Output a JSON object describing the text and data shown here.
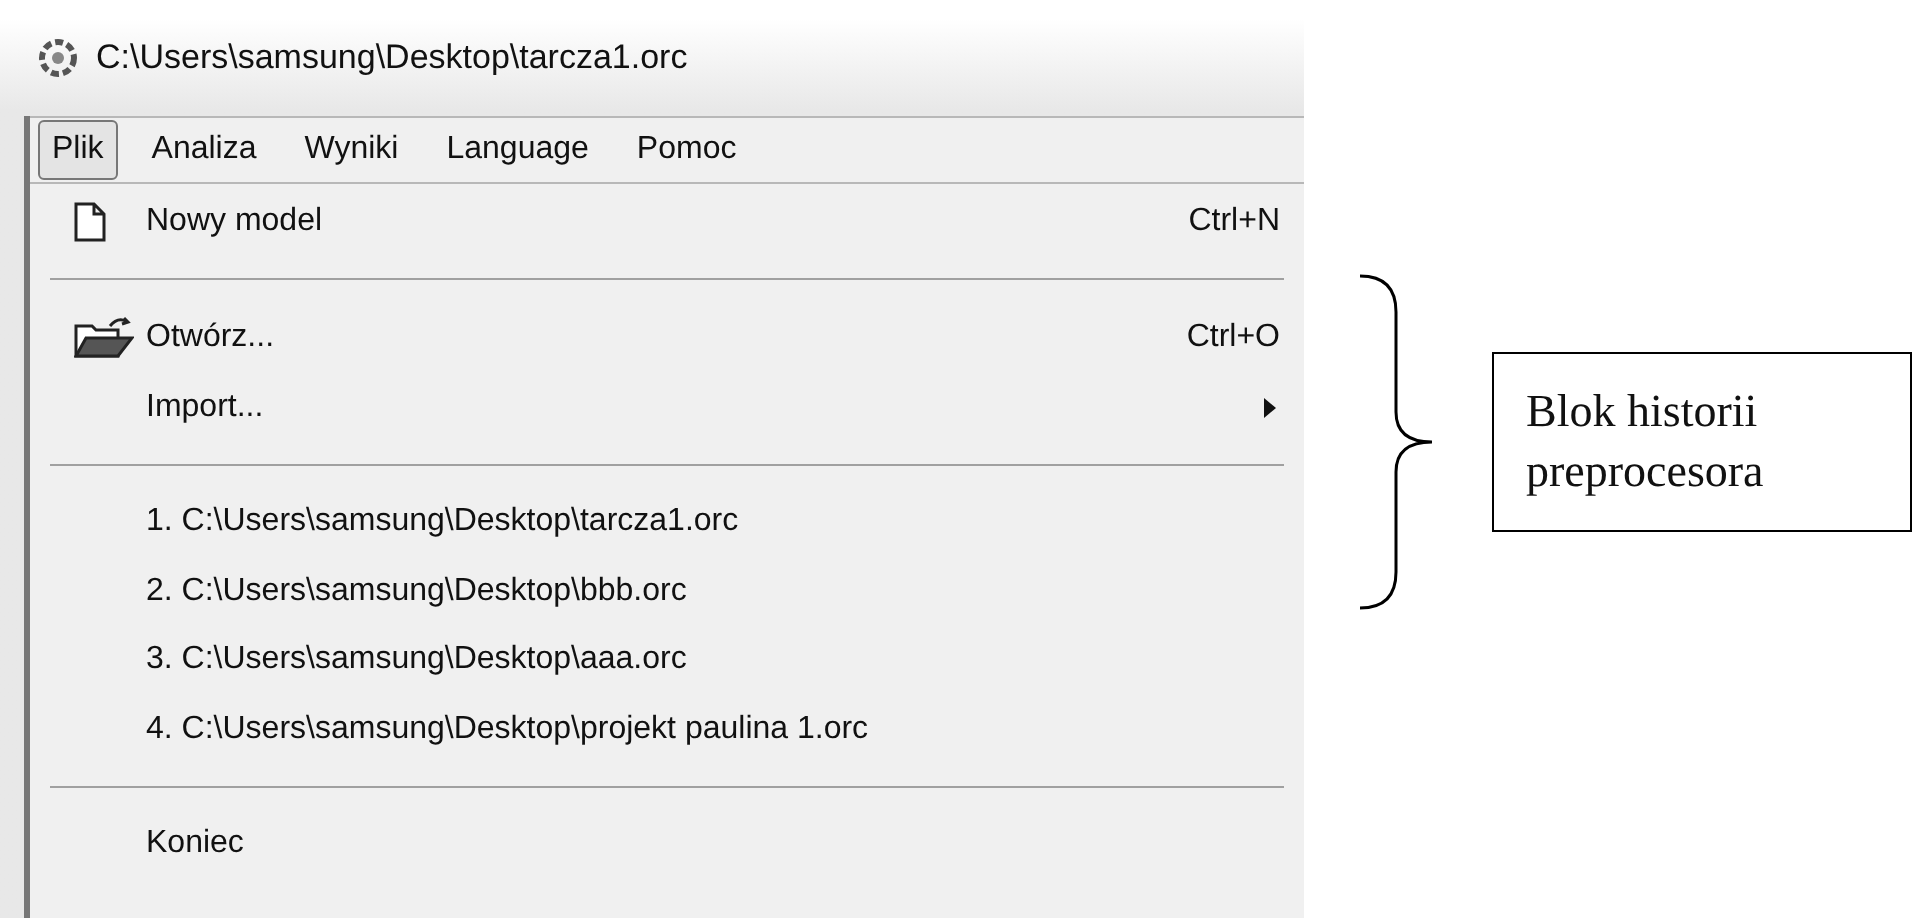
{
  "window": {
    "title": "C:\\Users\\samsung\\Desktop\\tarcza1.orc"
  },
  "menu_bar": [
    {
      "label": "Plik",
      "selected": true
    },
    {
      "label": "Analiza",
      "selected": false
    },
    {
      "label": "Wyniki",
      "selected": false
    },
    {
      "label": "Language",
      "selected": false
    },
    {
      "label": "Pomoc",
      "selected": false
    }
  ],
  "menu_items": [
    {
      "kind": "new",
      "label": "Nowy model",
      "shortcut": "Ctrl+N"
    },
    {
      "kind": "separator"
    },
    {
      "kind": "open",
      "label": "Otwórz...",
      "shortcut": "Ctrl+O"
    },
    {
      "kind": "submenu",
      "label": "Import..."
    },
    {
      "kind": "separator"
    },
    {
      "kind": "recent",
      "label": "1. C:\\Users\\samsung\\Desktop\\tarcza1.orc"
    },
    {
      "kind": "recent",
      "label": "2. C:\\Users\\samsung\\Desktop\\bbb.orc"
    },
    {
      "kind": "recent",
      "label": "3. C:\\Users\\samsung\\Desktop\\aaa.orc"
    },
    {
      "kind": "recent",
      "label": "4. C:\\Users\\samsung\\Desktop\\projekt paulina 1.orc"
    },
    {
      "kind": "separator"
    },
    {
      "kind": "plain",
      "label": "Koniec"
    }
  ],
  "annotation": {
    "label": "Blok historii preprocesora"
  }
}
